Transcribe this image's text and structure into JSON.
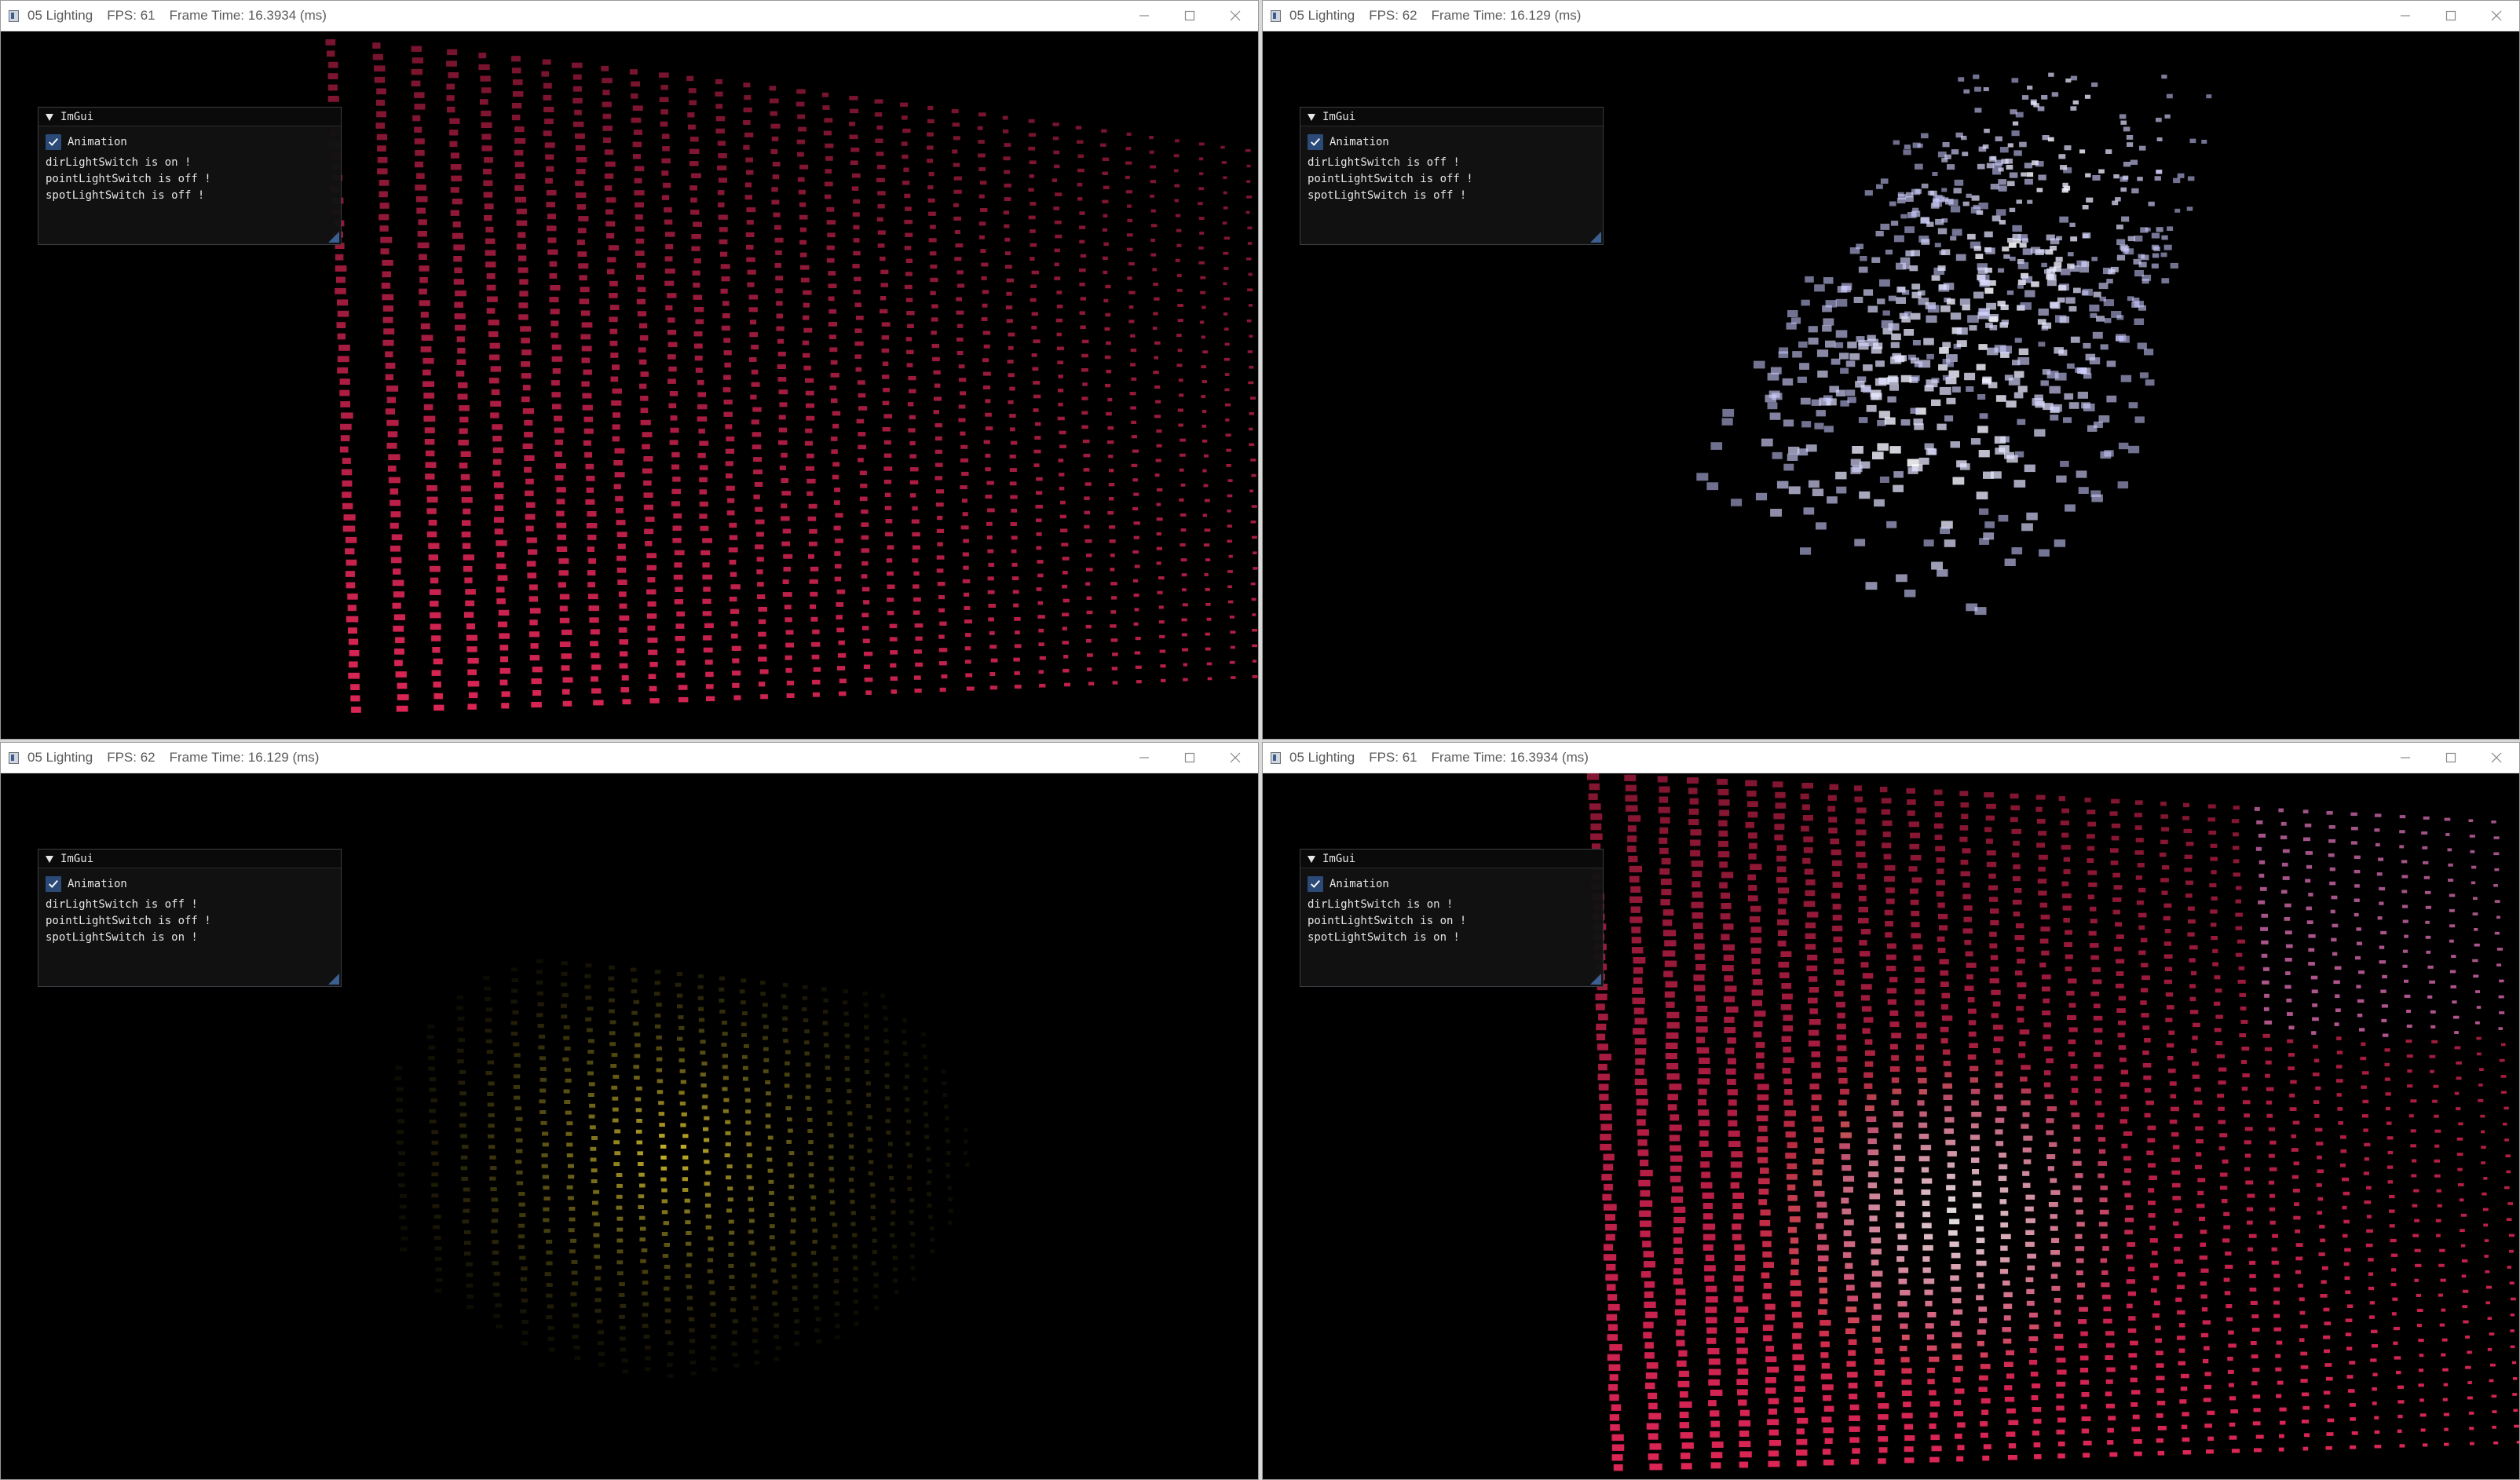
{
  "windows": [
    {
      "app_title": "05 Lighting",
      "fps": "FPS: 61",
      "frame_time": "Frame Time: 16.3934 (ms)",
      "imgui": {
        "title": "ImGui",
        "checkbox_label": "Animation",
        "lines": [
          "dirLightSwitch is on !",
          "pointLightSwitch is off !",
          "spotLightSwitch is off !"
        ]
      }
    },
    {
      "app_title": "05 Lighting",
      "fps": "FPS: 62",
      "frame_time": "Frame Time: 16.129 (ms)",
      "imgui": {
        "title": "ImGui",
        "checkbox_label": "Animation",
        "lines": [
          "dirLightSwitch is off !",
          "pointLightSwitch is off !",
          "spotLightSwitch is off !"
        ]
      }
    },
    {
      "app_title": "05 Lighting",
      "fps": "FPS: 62",
      "frame_time": "Frame Time: 16.129 (ms)",
      "imgui": {
        "title": "ImGui",
        "checkbox_label": "Animation",
        "lines": [
          "dirLightSwitch is off !",
          "pointLightSwitch is off !",
          "spotLightSwitch is on !"
        ]
      }
    },
    {
      "app_title": "05 Lighting",
      "fps": "FPS: 61",
      "frame_time": "Frame Time: 16.3934 (ms)",
      "imgui": {
        "title": "ImGui",
        "checkbox_label": "Animation",
        "lines": [
          "dirLightSwitch is on !",
          "pointLightSwitch is on !",
          "spotLightSwitch is on !"
        ]
      }
    }
  ],
  "icons": {
    "app": "app-window-icon",
    "minimize": "minimize-icon",
    "maximize": "maximize-icon",
    "close": "close-icon",
    "collapse": "collapse-triangle-icon",
    "check": "checkmark-icon"
  },
  "colors": {
    "dir_light": "#e8285a",
    "point_light": "#c8c8ff",
    "spot_light": "#c8b42a",
    "checkbox": "#2b4a77"
  },
  "animation_enabled": true
}
